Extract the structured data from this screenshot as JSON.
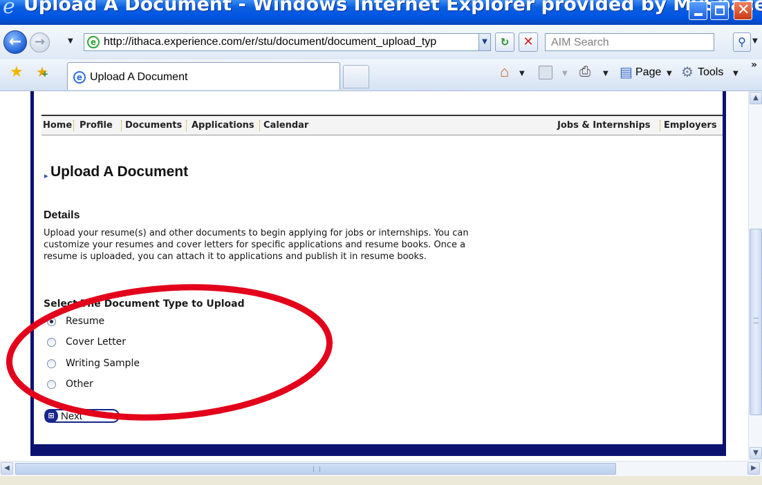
{
  "window": {
    "title": "Upload A Document - Windows Internet Explorer provided by MySpace"
  },
  "addressbar": {
    "url": "http://ithaca.experience.com/er/stu/document/document_upload_typ",
    "search_placeholder": "AIM Search"
  },
  "tabs": [
    {
      "label": "Upload A Document",
      "active": true
    }
  ],
  "command_bar": {
    "page_label": "Page",
    "tools_label": "Tools"
  },
  "site_nav": {
    "left": [
      "Home",
      "Profile",
      "Documents",
      "Applications",
      "Calendar"
    ],
    "right": [
      "Jobs & Internships",
      "Employers"
    ]
  },
  "page": {
    "title": "Upload A Document",
    "details_heading": "Details",
    "details_text": "Upload your resume(s) and other documents to begin applying for jobs or internships. You can customize your resumes and cover letters for specific applications and resume books. Once a resume is uploaded, you can attach it to applications and publish it in resume books.",
    "select_heading": "Select The Document Type to Upload",
    "document_types": [
      {
        "label": "Resume",
        "selected": true
      },
      {
        "label": "Cover Letter",
        "selected": false
      },
      {
        "label": "Writing Sample",
        "selected": false
      },
      {
        "label": "Other",
        "selected": false
      }
    ],
    "next_label": "Next"
  },
  "colors": {
    "frame": "#0c1270",
    "annotation": "#e3001b",
    "title_bar": "#0054e3"
  }
}
